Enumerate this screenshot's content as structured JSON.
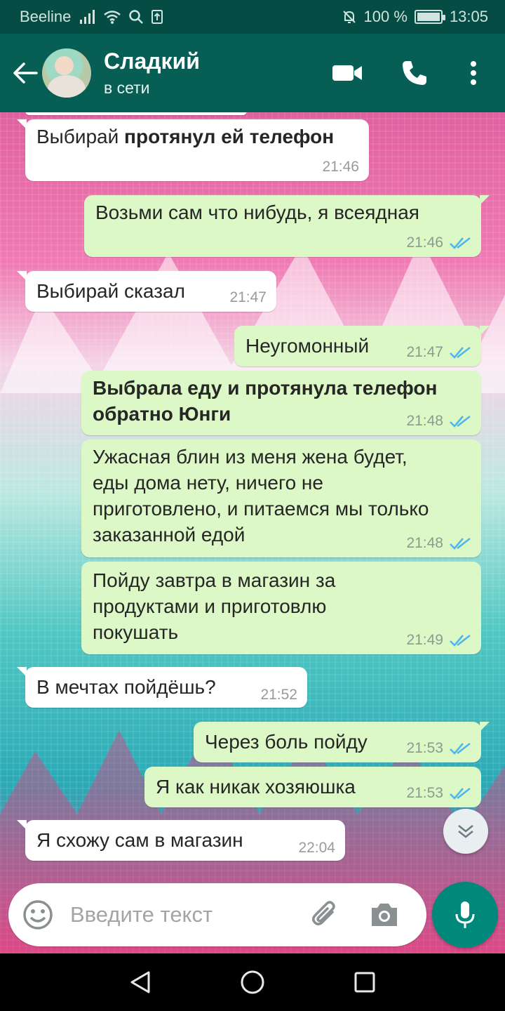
{
  "status_bar": {
    "carrier": "Beeline",
    "battery": "100 %",
    "battery_level": 1.0,
    "time": "13:05"
  },
  "header": {
    "contact_name": "Сладкий",
    "contact_status": "в сети",
    "icons": [
      "back-arrow-icon",
      "video-call-icon",
      "phone-icon",
      "more-options-icon"
    ]
  },
  "messages": [
    {
      "dir": "in",
      "text": "Выбирай ",
      "bold_text": "протянул ей телефон",
      "time": "21:46"
    },
    {
      "dir": "out",
      "text": "Возьми сам что нибудь, я всеядная",
      "time": "21:46",
      "read": true
    },
    {
      "dir": "in",
      "text": "Выбирай сказал",
      "time": "21:47"
    },
    {
      "dir": "out",
      "text": "Неугомонный",
      "time": "21:47",
      "read": true
    },
    {
      "dir": "out",
      "bold_text": "Выбрала еду и протянула телефон обратно Юнги",
      "time": "21:48",
      "read": true
    },
    {
      "dir": "out",
      "text": "Ужасная блин из меня жена будет, еды дома нету, ничего не приготовлено, и питаемся мы только заказанной едой",
      "time": "21:48",
      "read": true
    },
    {
      "dir": "out",
      "text": "Пойду завтра в магазин за продуктами и приготовлю покушать",
      "time": "21:49",
      "read": true
    },
    {
      "dir": "in",
      "text": "В мечтах пойдёшь?",
      "time": "21:52"
    },
    {
      "dir": "out",
      "text": "Через боль пойду",
      "time": "21:53",
      "read": true
    },
    {
      "dir": "out",
      "text": "Я как никак хозяюшка",
      "time": "21:53",
      "read": true
    },
    {
      "dir": "in",
      "text": "Я схожу сам в магазин",
      "time": "22:04"
    }
  ],
  "composer": {
    "placeholder": "Введите текст",
    "icons": [
      "emoji-icon",
      "attach-icon",
      "camera-icon",
      "mic-icon"
    ]
  },
  "colors": {
    "header": "#075e54",
    "status_bar": "#054d44",
    "outgoing_bubble": "#dcf8c6",
    "incoming_bubble": "#ffffff",
    "read_tick": "#4fb6ec",
    "mic_button": "#00897b"
  }
}
